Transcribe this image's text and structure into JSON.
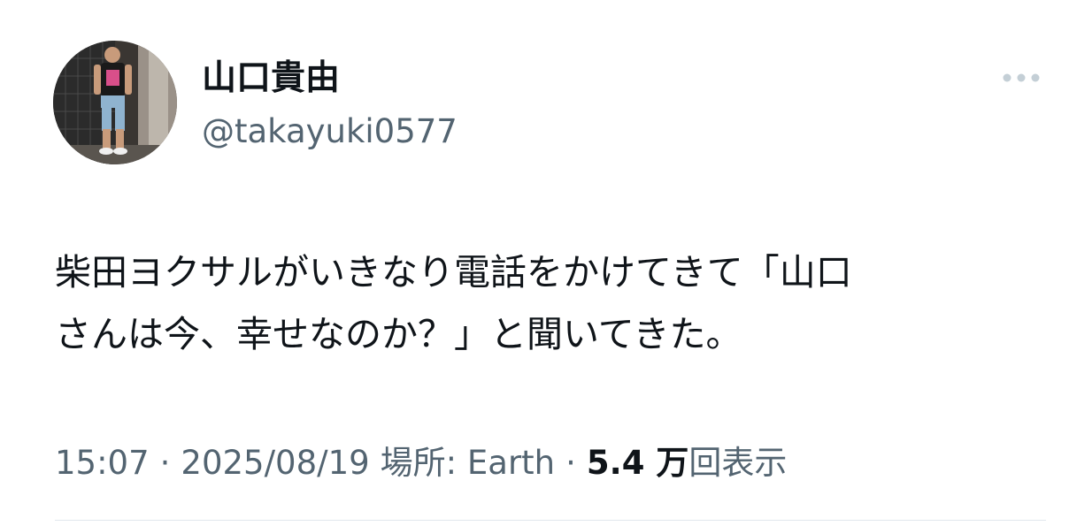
{
  "tweet": {
    "author": {
      "display_name": "山口貴由",
      "handle": "@takayuki0577",
      "avatar_icon": "user-photo-icon"
    },
    "more_icon": "more-horizontal-icon",
    "text_lines": [
      "柴田ヨクサルがいきなり電話をかけてきて「山口",
      "さんは今、幸せなのか？」と聞いてきた。"
    ],
    "meta": {
      "time": "15:07",
      "separator": "·",
      "date": "2025/08/19",
      "location": "場所: Earth",
      "views_count": "5.4 万",
      "views_label": "回表示"
    }
  },
  "colors": {
    "text_primary": "#0f1419",
    "text_secondary": "#536471",
    "icon_gray": "#c4cfd6",
    "divider": "#e1e8ed"
  }
}
